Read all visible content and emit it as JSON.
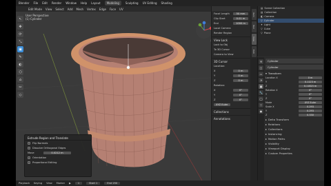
{
  "topbar": {
    "menu": [
      "Blender",
      "File",
      "Edit",
      "Render",
      "Window",
      "Help"
    ],
    "workspace_tabs": [
      "Layout",
      "Modeling",
      "Sculpting",
      "UV Editing",
      "Shading"
    ],
    "active_tab": "Modeling"
  },
  "viewport": {
    "header": [
      "Edit Mode",
      "View",
      "Select",
      "Add",
      "Mesh",
      "Vertex",
      "Edge",
      "Face",
      "UV"
    ],
    "info_line1": "User Perspective",
    "info_line2": "(1) Cylinder",
    "tools": [
      "↖",
      "✥",
      "⟳",
      "⤡",
      "▣",
      "✎",
      "◐",
      "⬡",
      "⌂",
      "✂",
      "◇"
    ],
    "active_tool_index": 4
  },
  "n_panel": {
    "rows": [
      {
        "label": "Focal Length",
        "value": "50 mm"
      },
      {
        "label": "Clip Start",
        "value": "0.01 m"
      },
      {
        "label": "End",
        "value": "1000 m"
      },
      {
        "label": "Local Camera",
        "value": ""
      },
      {
        "label": "Render Region",
        "value": ""
      }
    ],
    "view_lock": "View Lock",
    "lock_to_object": "Lock to Obj",
    "lock_3d_cursor": "To 3D Cursor",
    "camera_to_view": "Camera to View",
    "cursor_section": "3D Cursor",
    "location_label": "Location:",
    "location": [
      {
        "axis": "X",
        "value": "0 m"
      },
      {
        "axis": "Y",
        "value": "0 m"
      },
      {
        "axis": "Z",
        "value": "0 m"
      }
    ],
    "rotation_label": "Rotation:",
    "rotation": [
      {
        "axis": "X",
        "value": "0°"
      },
      {
        "axis": "Y",
        "value": "0°"
      },
      {
        "axis": "Z",
        "value": "0°"
      }
    ],
    "mode": "XYZ Euler",
    "collections": "Collections",
    "annotations": "Annotations",
    "tabs": [
      "Item",
      "Tool",
      "View",
      "Edit"
    ]
  },
  "operator_panel": {
    "title": "Extrude Region and Translate",
    "options": [
      {
        "label": "Flip Normals",
        "checked": false
      },
      {
        "label": "Dissolve Orthogonal Edges",
        "checked": false
      }
    ],
    "move_label": "Move",
    "move_value": "0.0212 m",
    "more_options": [
      {
        "label": "Orientation",
        "checked": false
      },
      {
        "label": "Proportional Editing",
        "checked": false
      }
    ]
  },
  "outliner": {
    "rows": [
      {
        "name": "Scene Collection",
        "selected": false
      },
      {
        "name": "Collection",
        "selected": false
      },
      {
        "name": "Camera",
        "selected": false
      },
      {
        "name": "Cylinder",
        "selected": true
      },
      {
        "name": "Light",
        "selected": false
      },
      {
        "name": "Cube",
        "selected": false
      },
      {
        "name": "Plane",
        "selected": false
      }
    ]
  },
  "properties": {
    "object_name": "Cylinder",
    "sub_name": "Cylinder",
    "transform": "Transform",
    "location": [
      {
        "axis": "Location X",
        "value": "0 m"
      },
      {
        "axis": "Y",
        "value": "0.1123 m"
      },
      {
        "axis": "Z",
        "value": "0.11823 m"
      }
    ],
    "rotation": [
      {
        "axis": "Rotation X",
        "value": "0°"
      },
      {
        "axis": "Y",
        "value": "0°"
      },
      {
        "axis": "Z",
        "value": "0°"
      }
    ],
    "mode_label": "Mode",
    "mode_value": "XYZ Euler",
    "scale": [
      {
        "axis": "Scale X",
        "value": "0.293"
      },
      {
        "axis": "Y",
        "value": "0.293"
      },
      {
        "axis": "Z",
        "value": "0.330"
      }
    ],
    "collapsed": [
      "Delta Transform",
      "Relations",
      "Collections",
      "Instancing",
      "Motion Paths",
      "Visibility",
      "Viewport Display",
      "Custom Properties"
    ]
  },
  "timeline": {
    "items": [
      "Playback",
      "Keying",
      "View",
      "Marker"
    ],
    "frame": "1",
    "start": "Start 1",
    "end": "End 250"
  },
  "colors": {
    "mesh": "#b58073",
    "rim": "#d0926a",
    "accent": "#3c8ed8"
  }
}
